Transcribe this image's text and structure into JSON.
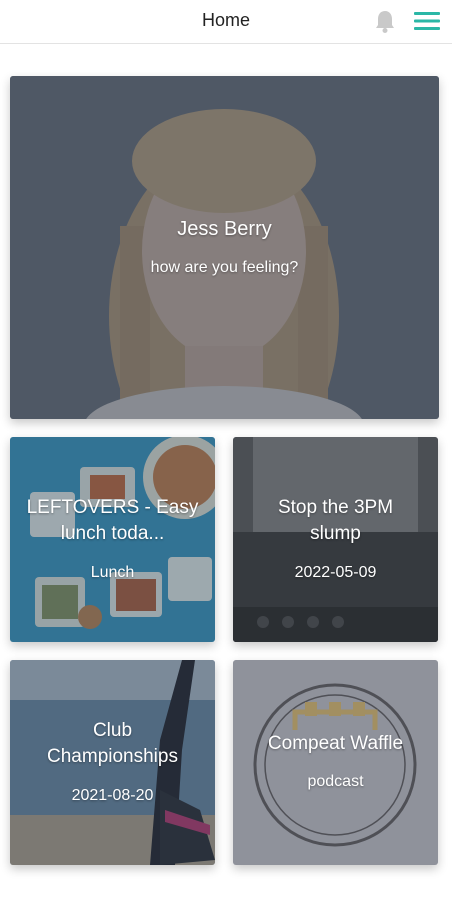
{
  "header": {
    "title": "Home",
    "icons": [
      "bell-icon",
      "hamburger-menu-icon"
    ],
    "accent_color": "#2bb7a6"
  },
  "hero": {
    "title": "Jess Berry",
    "subtitle": "how are you feeling?"
  },
  "tiles": [
    {
      "title": "LEFTOVERS - Easy lunch toda...",
      "subtitle": "Lunch"
    },
    {
      "title": "Stop the 3PM slump",
      "subtitle": "2022-05-09"
    },
    {
      "title": "Club Championships",
      "subtitle": "2021-08-20"
    },
    {
      "title": "Compeat Waffle",
      "subtitle": "podcast"
    }
  ]
}
